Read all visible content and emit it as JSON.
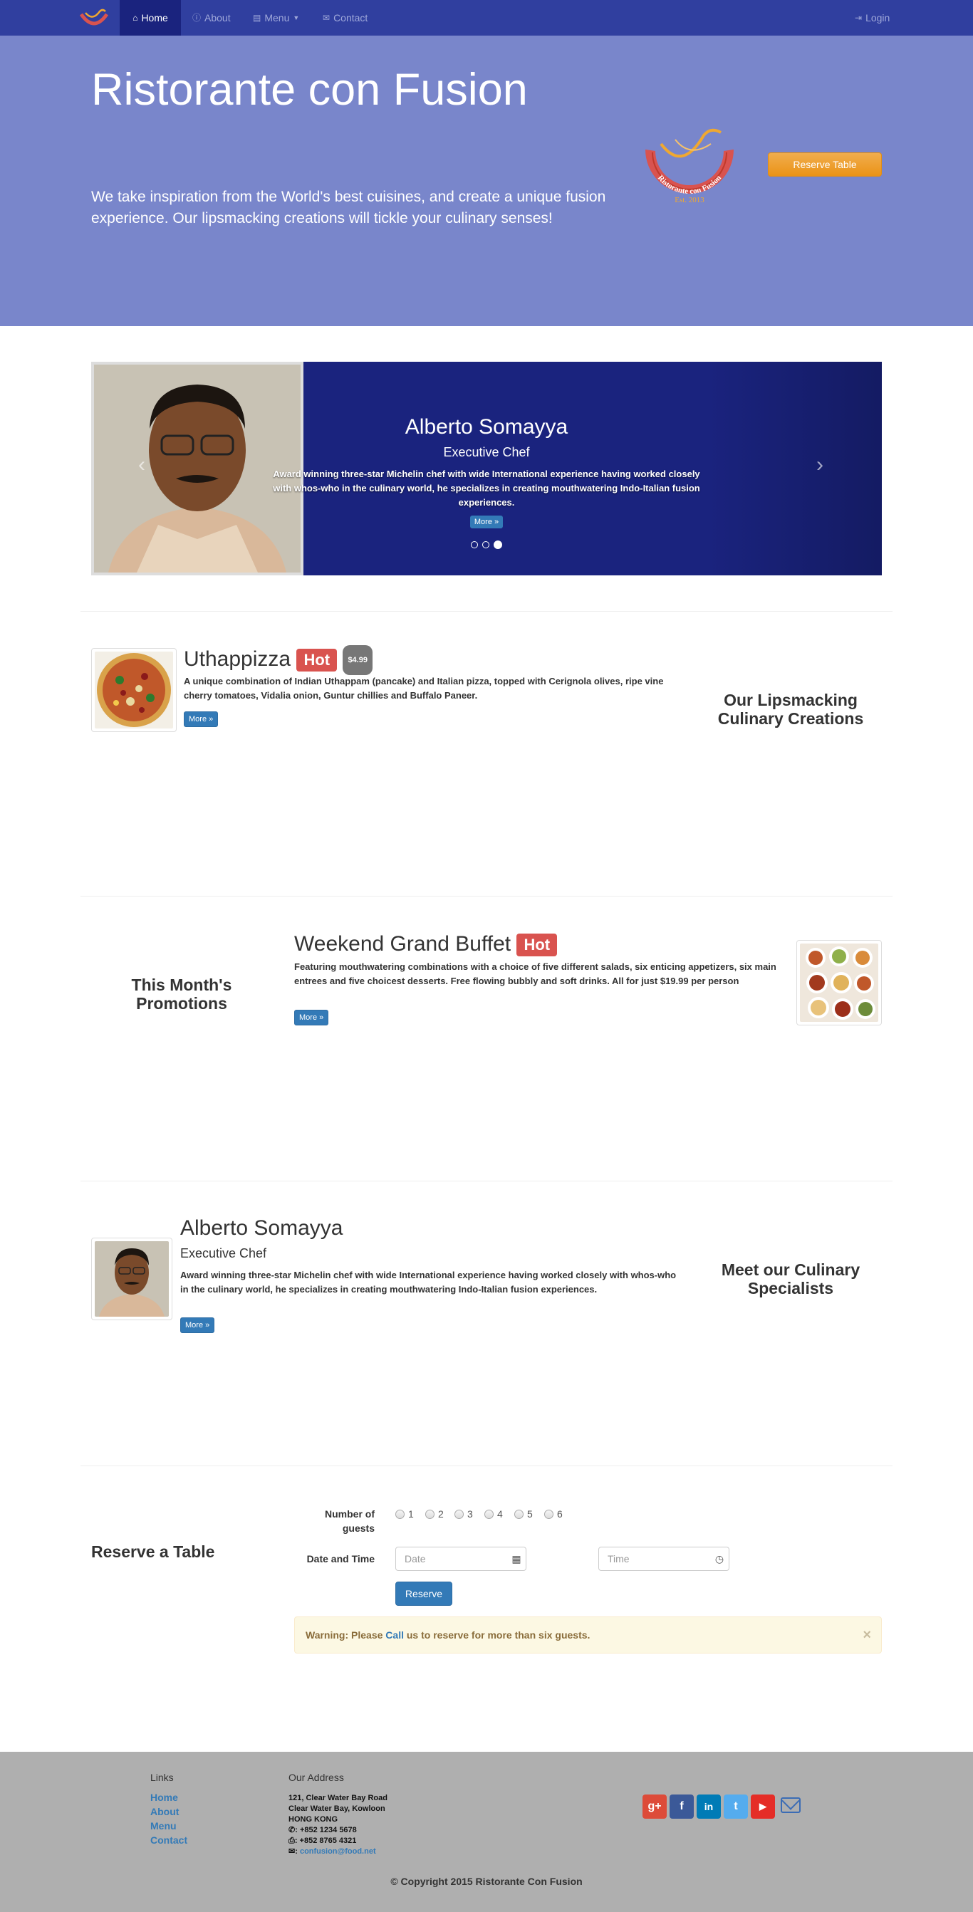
{
  "nav": {
    "items": [
      {
        "label": "Home",
        "icon": "home-icon",
        "active": true
      },
      {
        "label": "About",
        "icon": "info-icon"
      },
      {
        "label": "Menu",
        "icon": "list-icon"
      },
      {
        "label": "Contact",
        "icon": "envelope-icon"
      }
    ],
    "login": "Login"
  },
  "jumbotron": {
    "title": "Ristorante con Fusion",
    "lead": "We take inspiration from the World's best cuisines, and create a unique fusion experience. Our lipsmacking creations will tickle your culinary senses!",
    "logo_text": "Ristorante con Fusion",
    "logo_est": "Est. 2013",
    "reserve": "Reserve Table"
  },
  "carousel": {
    "name": "Alberto Somayya",
    "role": "Executive Chef",
    "description": "Award winning three-star Michelin chef with wide International experience having worked closely with whos-who in the culinary world, he specializes in creating mouthwatering Indo-Italian fusion experiences.",
    "more": "More »",
    "slides": 3,
    "active_slide": 3
  },
  "dish": {
    "name": "Uthappizza",
    "label": "Hot",
    "price": "$4.99",
    "description": "A unique combination of Indian Uthappam (pancake) and Italian pizza, topped with Cerignola olives, ripe vine cherry tomatoes, Vidalia onion, Guntur chillies and Buffalo Paneer.",
    "more": "More »",
    "side_heading": "Our Lipsmacking Culinary Creations"
  },
  "promotion": {
    "name": "Weekend Grand Buffet",
    "label": "Hot",
    "description": "Featuring mouthwatering combinations with a choice of five different salads, six enticing appetizers, six main entrees and five choicest desserts. Free flowing bubbly and soft drinks. All for just $19.99 per person",
    "more": "More »",
    "side_heading": "This Month's Promotions"
  },
  "leader": {
    "name": "Alberto Somayya",
    "role": "Executive Chef",
    "description": "Award winning three-star Michelin chef with wide International experience having worked closely with whos-who in the culinary world, he specializes in creating mouthwatering Indo-Italian fusion experiences.",
    "more": "More »",
    "side_heading": "Meet our Culinary Specialists"
  },
  "reservation": {
    "heading": "Reserve a Table",
    "guests_label": "Number of guests",
    "guest_options": [
      "1",
      "2",
      "3",
      "4",
      "5",
      "6"
    ],
    "datetime_label": "Date and Time",
    "date_placeholder": "Date",
    "time_placeholder": "Time",
    "submit": "Reserve",
    "warning_prefix": "Warning: Please ",
    "warning_link": "Call",
    "warning_suffix": " us to reserve for more than six guests.",
    "close": "×"
  },
  "footer": {
    "links_heading": "Links",
    "links": [
      "Home",
      "About",
      "Menu",
      "Contact"
    ],
    "address_heading": "Our Address",
    "address": [
      "121, Clear Water Bay Road",
      "Clear Water Bay, Kowloon",
      "HONG KONG"
    ],
    "phone": "+852 1234 5678",
    "fax": "+852 8765 4321",
    "email": "confusion@food.net",
    "social": [
      {
        "icon": "google-plus-icon",
        "glyph": "g+",
        "color": "#dd4b39"
      },
      {
        "icon": "facebook-icon",
        "glyph": "f",
        "color": "#3b5998"
      },
      {
        "icon": "linkedin-icon",
        "glyph": "in",
        "color": "#007bb6"
      },
      {
        "icon": "twitter-icon",
        "glyph": "t",
        "color": "#55acee"
      },
      {
        "icon": "youtube-icon",
        "glyph": "▶",
        "color": "#e52d27"
      }
    ],
    "copyright": "© Copyright 2015 Ristorante Con Fusion"
  }
}
